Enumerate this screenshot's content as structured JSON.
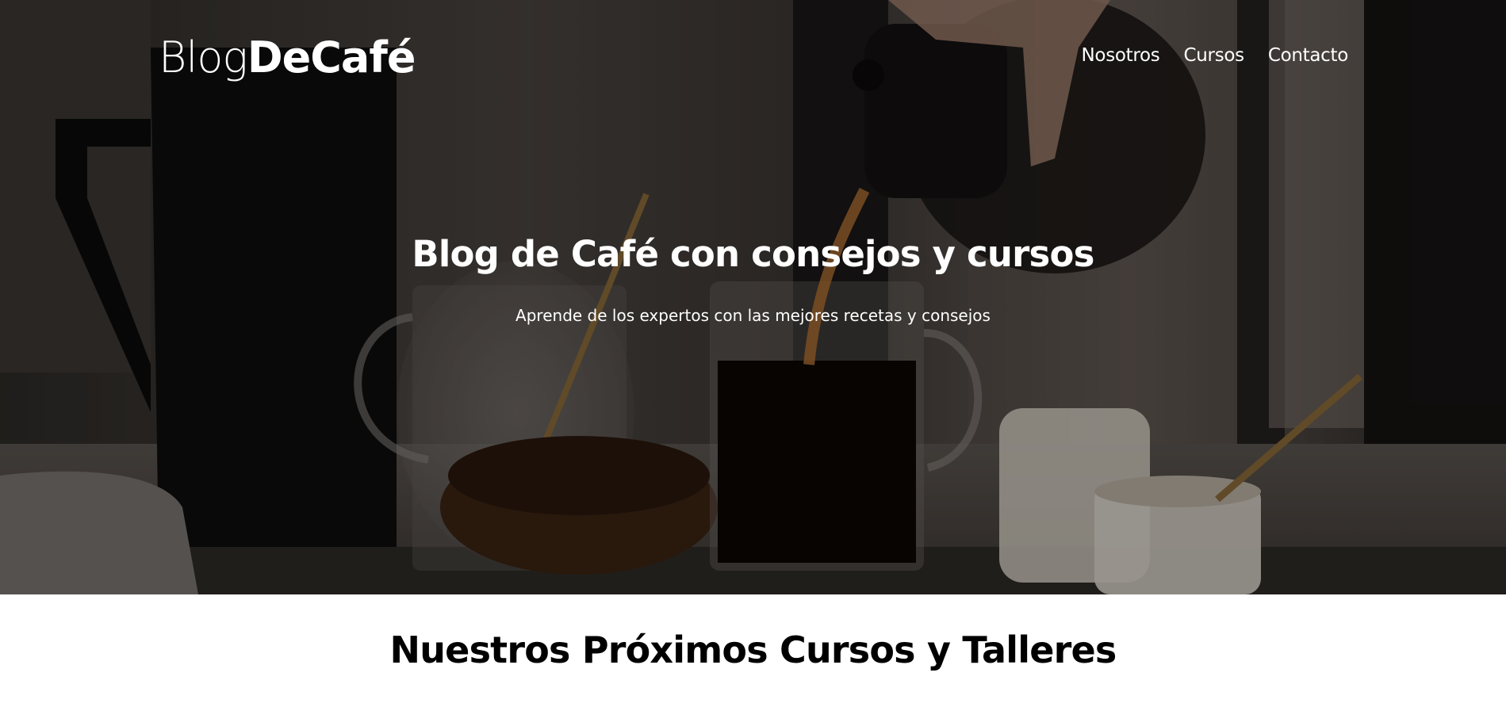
{
  "header": {
    "logo_light": "Blog",
    "logo_bold": "DeCafé",
    "nav": [
      {
        "label": "Nosotros"
      },
      {
        "label": "Cursos"
      },
      {
        "label": "Contacto"
      }
    ]
  },
  "hero": {
    "title": "Blog de Café con consejos y cursos",
    "subtitle": "Aprende de los expertos con las mejores recetas y consejos"
  },
  "courses": {
    "title": "Nuestros Próximos Cursos y Talleres"
  },
  "colors": {
    "text_light": "#ffffff",
    "text_dark": "#000000",
    "page_background": "#ffffff"
  }
}
